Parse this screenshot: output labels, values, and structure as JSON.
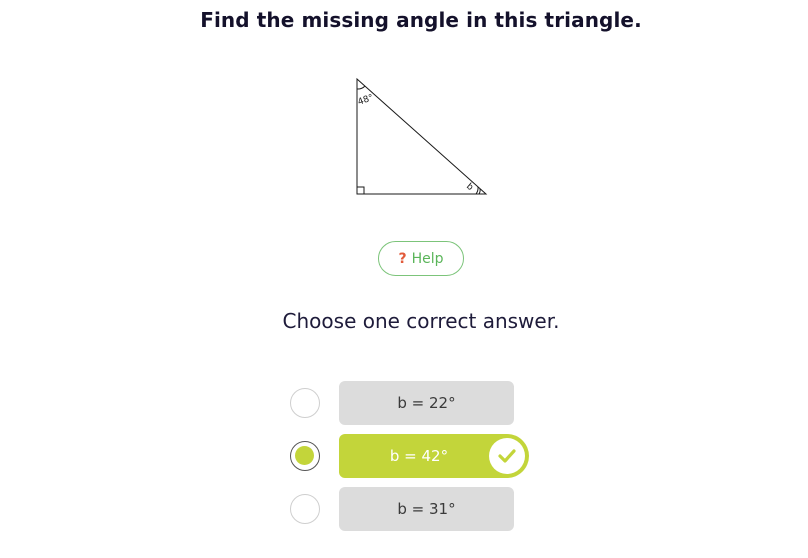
{
  "question": {
    "title": "Find the missing angle in this triangle."
  },
  "figure": {
    "angle_top_label": "48°",
    "angle_bottom_label": "b"
  },
  "help": {
    "icon_text": "?",
    "label": "Help"
  },
  "instruction": "Choose one correct answer.",
  "options": [
    {
      "label": "b = 22°",
      "selected": false
    },
    {
      "label": "b = 42°",
      "selected": true
    },
    {
      "label": "b = 31°",
      "selected": false
    }
  ],
  "colors": {
    "accent": "#c3d53a",
    "help_border": "#7cc47a",
    "help_text": "#5bb55a",
    "help_icon": "#e25b3b",
    "unselected_option": "#dcdcdc"
  }
}
